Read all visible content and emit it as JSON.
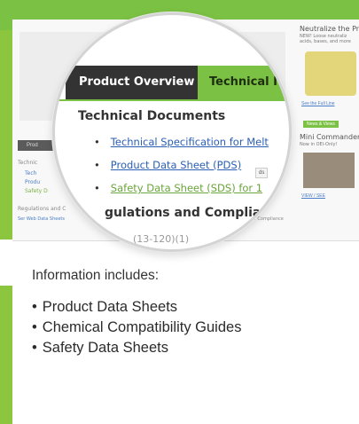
{
  "background": {
    "left_tab_fragment": "Prod",
    "technical_label": "Technic",
    "link1": "Tech",
    "link2": "Produ",
    "link3": "Safety D",
    "regulations_fragment": "Regulations and C",
    "small_link": "Ser Web Data Sheets",
    "small_note": "of Compliance"
  },
  "sidebar": {
    "title": "Neutralize the Pr",
    "subtitle_1": "NEW! Loose neutraliz",
    "subtitle_2": "acids, bases, and more",
    "see_full_line": "See the Full Line",
    "news_badge": "News & Views",
    "commander_title": "Mini Commander",
    "commander_sub": "Now in OEl-Only!",
    "view_link": "VIEW / SEE"
  },
  "magnifier": {
    "tab_overview": "Product Overview",
    "tab_technical": "Technical I",
    "heading": "Technical Documents",
    "items": [
      "Technical Specification for Melt",
      "Product Data Sheet (PDS)",
      "Safety Data Sheet (SDS) for 1"
    ],
    "box_fragment": "ds",
    "heading2": "gulations and Complia",
    "fragment": "(13-120)(1)"
  },
  "info": {
    "intro": "Information includes:",
    "items": [
      "Product Data Sheets",
      "Chemical Compatibility Guides",
      "Safety Data Sheets"
    ]
  },
  "colors": {
    "accent_green": "#7bc143",
    "tab_dark": "#333333",
    "link_blue": "#2a5fb4"
  }
}
